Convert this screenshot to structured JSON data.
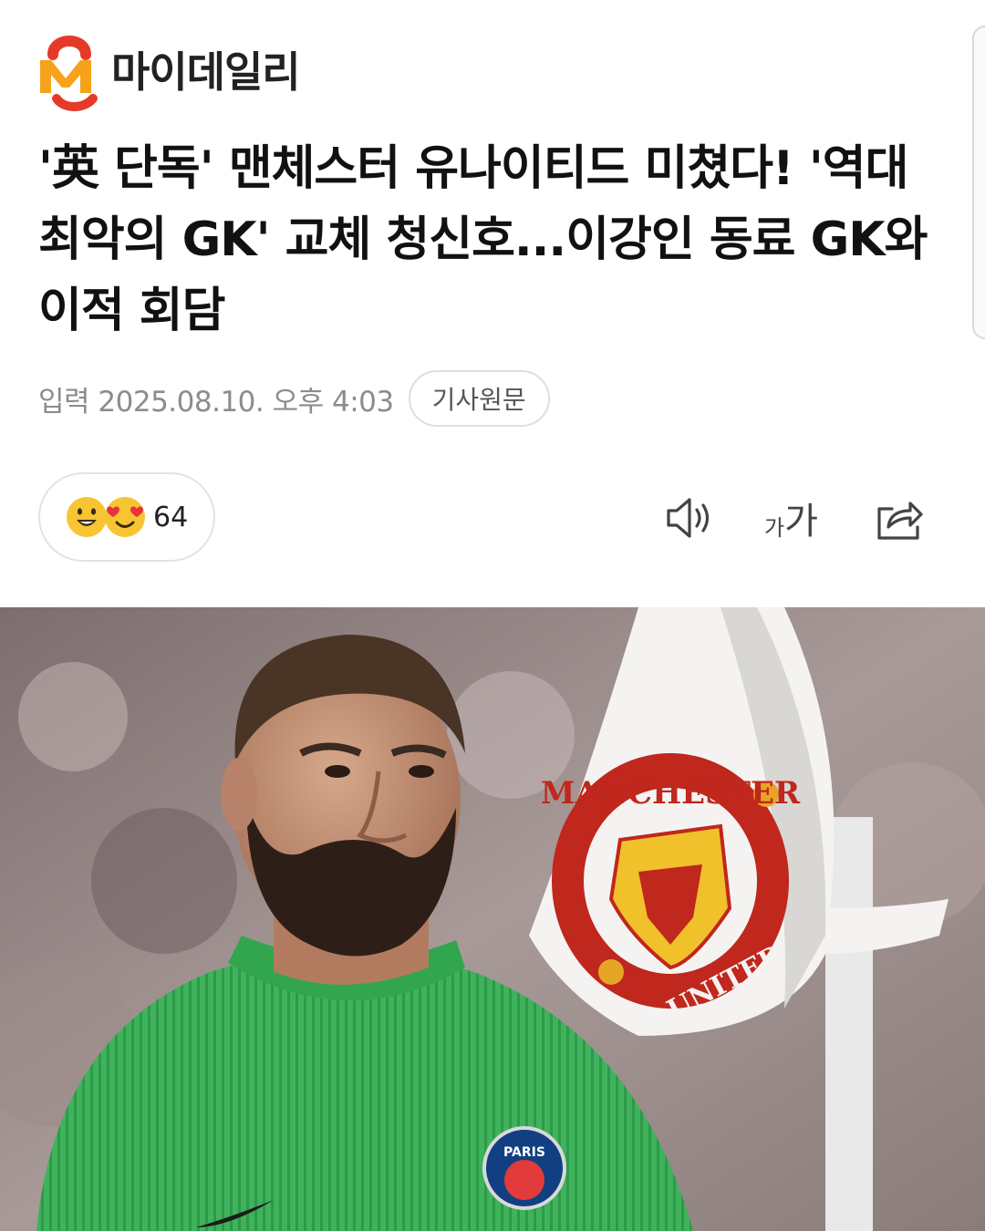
{
  "brand": {
    "name": "마이데일리",
    "colors": {
      "red": "#e53a2a",
      "orange": "#f6a21b"
    }
  },
  "article": {
    "title": "'英 단독' 맨체스터 유나이티드 미쳤다! '역대 최악의 GK' 교체 청신호...이강인 동료 GK와 이적 회담",
    "date": "입력 2025.08.10. 오후 4:03",
    "source_button": "기사원문",
    "reaction_count": "64",
    "font_small": "가",
    "font_large": "가"
  },
  "icons": [
    "smile-emoji-icon",
    "heart-eyes-emoji-icon",
    "speaker-icon",
    "font-size-icon",
    "share-icon"
  ],
  "photo": {
    "crest_top_text": "MANCHESTER",
    "crest_left_text": "MANCHESTER",
    "crest_bottom_text": "UNITED",
    "badge_text": "PARIS"
  }
}
